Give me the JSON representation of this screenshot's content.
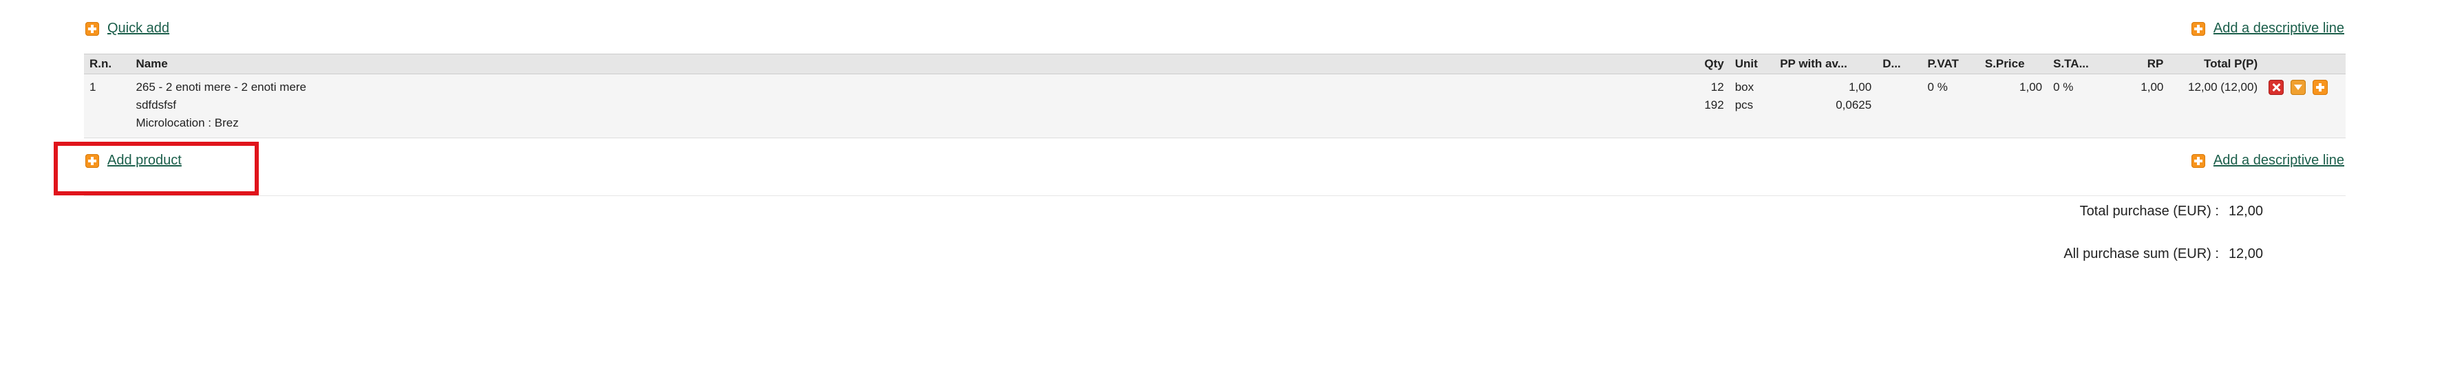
{
  "links": {
    "quick_add": "Quick add",
    "add_descriptive_line_top": "Add a descriptive line",
    "add_product": "Add product",
    "add_descriptive_line_bottom": "Add a descriptive line"
  },
  "table": {
    "headers": {
      "rn": "R.n.",
      "name": "Name",
      "qty": "Qty",
      "unit": "Unit",
      "pp": "PP with av...",
      "d": "D...",
      "pvat": "P.VAT",
      "sprice": "S.Price",
      "sta": "S.TA...",
      "rp": "RP",
      "total": "Total P(P)"
    },
    "rows": [
      {
        "rn": "1",
        "name_line1": "265 - 2 enoti mere - 2 enoti mere",
        "name_line2": "sdfdsfsf",
        "name_line3": "Microlocation : Brez",
        "qty1": "12",
        "qty2": "192",
        "unit1": "box",
        "unit2": "pcs",
        "pp1": "1,00",
        "pp2": "0,0625",
        "d": "",
        "pvat": "0 %",
        "sprice": "1,00",
        "sta": "0 %",
        "rp": "1,00",
        "total": "12,00 (12,00)"
      }
    ]
  },
  "totals": {
    "total_purchase_label": "Total purchase (EUR) :",
    "total_purchase_value": "12,00",
    "all_purchase_label": "All purchase sum (EUR) :",
    "all_purchase_value": "12,00"
  },
  "icons": {
    "plus": "plus-icon",
    "delete": "delete-icon",
    "move_down": "move-down-icon",
    "insert_row": "insert-row-icon"
  },
  "colors": {
    "link": "#1a5e4a",
    "highlight_box": "#e0141b",
    "icon_orange": "#f7941d",
    "icon_red": "#d9302c"
  }
}
